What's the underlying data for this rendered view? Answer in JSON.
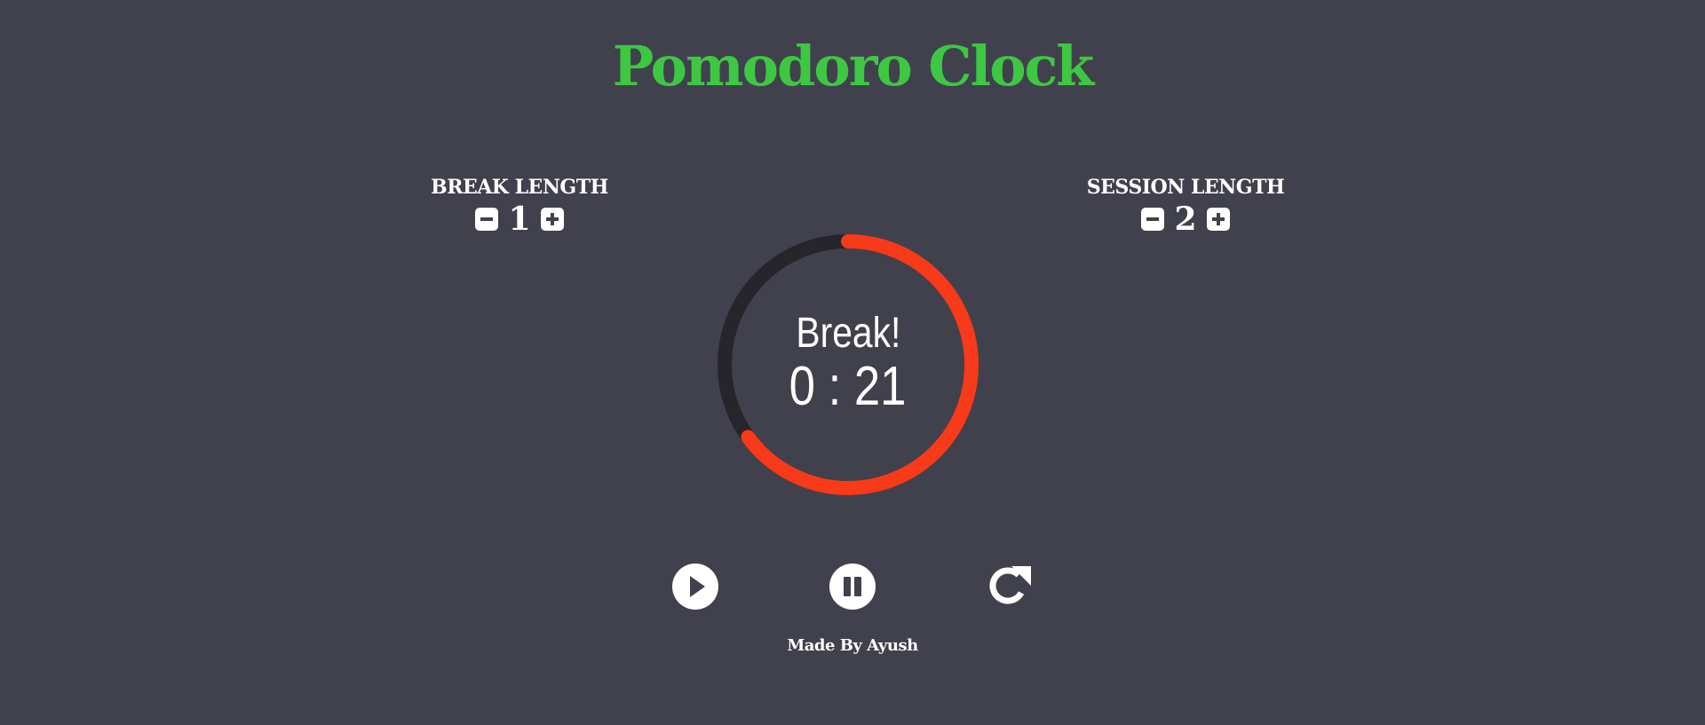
{
  "app": {
    "title": "Pomodoro Clock",
    "credit": "Made By Ayush"
  },
  "break_length": {
    "label": "BREAK LENGTH",
    "value": "1",
    "decrement_icon": "minus-square-icon",
    "increment_icon": "plus-square-icon"
  },
  "session_length": {
    "label": "SESSION LENGTH",
    "value": "2",
    "decrement_icon": "minus-square-icon",
    "increment_icon": "plus-square-icon"
  },
  "timer": {
    "label": "Break!",
    "time": "0 : 21",
    "progress_fraction": 0.65
  },
  "controls": {
    "play_icon": "play-circle-icon",
    "pause_icon": "pause-circle-icon",
    "reset_icon": "redo-icon"
  },
  "colors": {
    "background": "#41414d",
    "title": "#3ec743",
    "progress": "#f73a1a",
    "track": "#25252b",
    "foreground": "#ffffff"
  }
}
